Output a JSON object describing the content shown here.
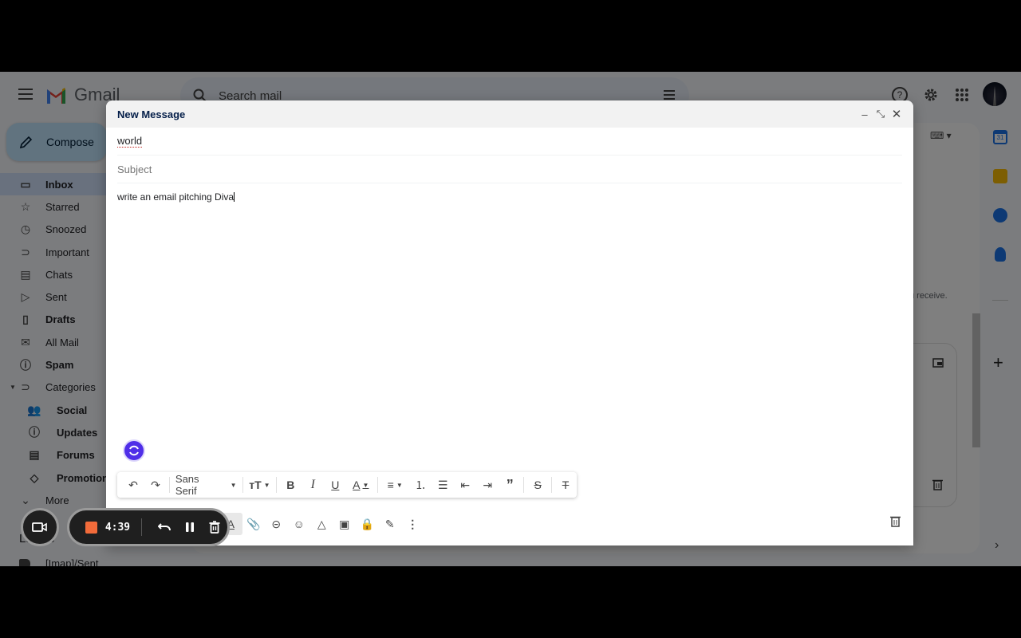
{
  "app": {
    "name": "Gmail"
  },
  "header": {
    "search_placeholder": "Search mail",
    "icons": [
      "menu-icon",
      "search-icon",
      "filter-options-icon",
      "help-icon",
      "settings-icon",
      "apps-grid-icon",
      "account-avatar"
    ]
  },
  "sidebar": {
    "compose_label": "Compose",
    "items": [
      {
        "label": "Inbox",
        "icon": "inbox-icon",
        "active": true
      },
      {
        "label": "Starred",
        "icon": "star-icon"
      },
      {
        "label": "Snoozed",
        "icon": "clock-icon"
      },
      {
        "label": "Important",
        "icon": "important-icon"
      },
      {
        "label": "Chats",
        "icon": "chat-icon"
      },
      {
        "label": "Sent",
        "icon": "send-icon"
      },
      {
        "label": "Drafts",
        "icon": "draft-icon",
        "bold": true
      },
      {
        "label": "All Mail",
        "icon": "all-mail-icon"
      },
      {
        "label": "Spam",
        "icon": "spam-icon",
        "bold": true
      },
      {
        "label": "Categories",
        "icon": "label-icon",
        "expanded": true
      },
      {
        "label": "Social",
        "icon": "people-icon",
        "bold": true
      },
      {
        "label": "Updates",
        "icon": "info-icon",
        "bold": true
      },
      {
        "label": "Forums",
        "icon": "forum-icon",
        "bold": true
      },
      {
        "label": "Promotions",
        "icon": "tag-icon",
        "bold": true
      },
      {
        "label": "More",
        "icon": "chevron-down-icon"
      }
    ],
    "labels_heading": "Labels",
    "labels": [
      {
        "label": "[Imap]/Sent"
      }
    ]
  },
  "background": {
    "receive_text": "u receive."
  },
  "compose": {
    "title": "New Message",
    "to_value": "world",
    "subject_placeholder": "Subject",
    "body": "write an email pitching Diva",
    "format_toolbar": {
      "font_family": "Sans Serif",
      "buttons": [
        "undo",
        "redo",
        "font-family",
        "font-size",
        "bold",
        "italic",
        "underline",
        "text-color",
        "align",
        "numbered-list",
        "bulleted-list",
        "indent-less",
        "indent-more",
        "quote",
        "strikethrough",
        "remove-formatting"
      ]
    },
    "bottom_toolbar": [
      "formatting-options",
      "attach-file",
      "insert-link",
      "insert-emoji",
      "insert-drive-file",
      "insert-photo",
      "confidential-mode",
      "insert-signature",
      "more-options"
    ]
  },
  "recorder": {
    "time": "4:39",
    "stop_color": "#f26b3a"
  }
}
